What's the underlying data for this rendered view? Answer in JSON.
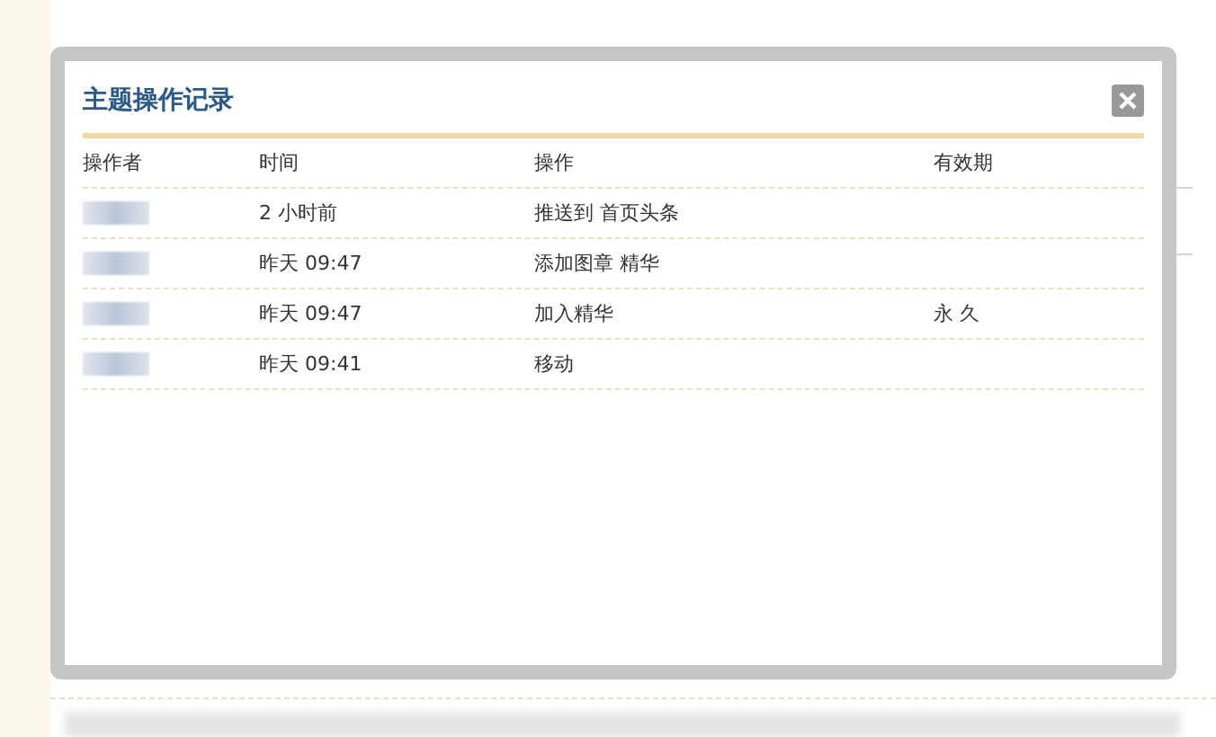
{
  "dialog": {
    "title": "主题操作记录",
    "columns": [
      "操作者",
      "时间",
      "操作",
      "有效期"
    ],
    "rows": [
      {
        "time": "2 小时前",
        "action": "推送到 首页头条"
      },
      {
        "time": "昨天 09:47",
        "action": "添加图章 精华"
      },
      {
        "time": "昨天 09:47",
        "action": "加入精华",
        "validity": "永 久"
      },
      {
        "time": "昨天 09:41",
        "action": "移动"
      }
    ]
  }
}
